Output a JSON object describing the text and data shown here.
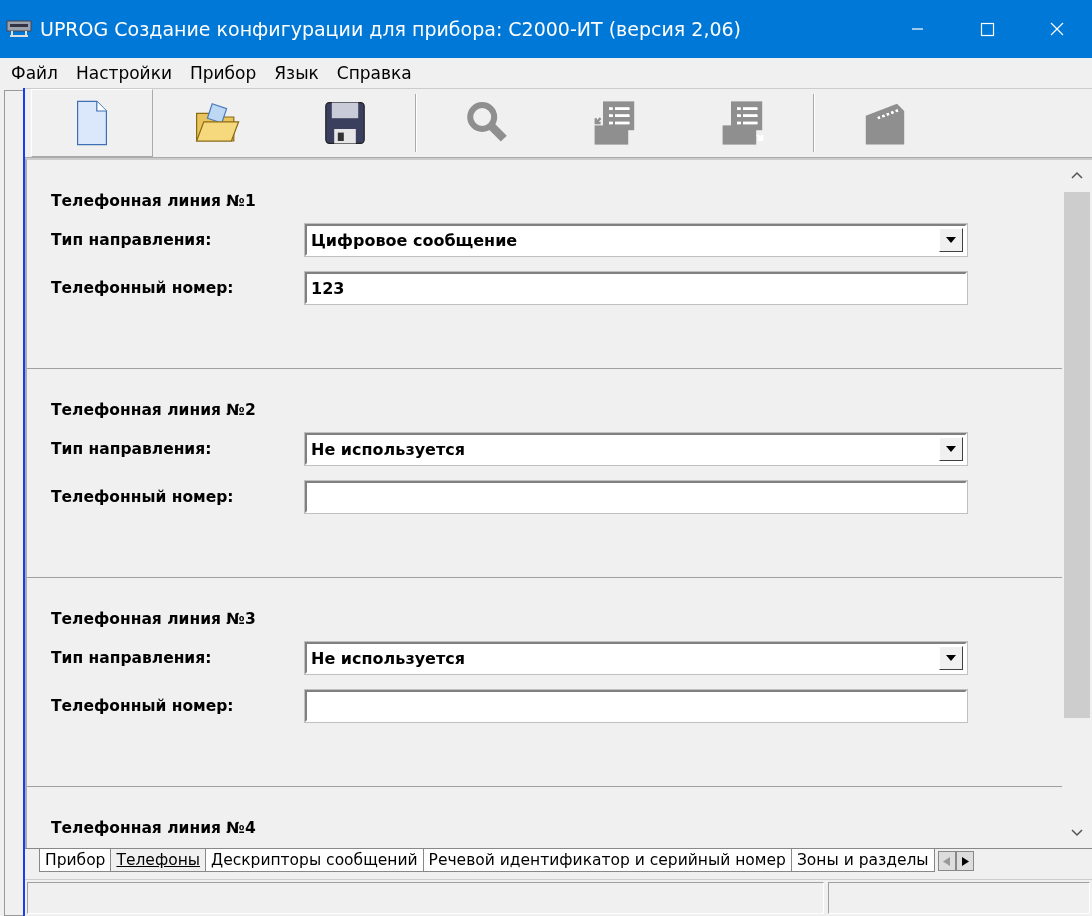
{
  "window": {
    "title": "UPROG  Создание конфигурации для прибора: С2000-ИТ (версия  2,06)"
  },
  "menu": [
    "Файл",
    "Настройки",
    "Прибор",
    "Язык",
    "Справка"
  ],
  "toolbar": [
    {
      "kind": "new",
      "disabled": false
    },
    {
      "kind": "open",
      "disabled": false
    },
    {
      "kind": "save",
      "disabled": false
    },
    {
      "kind": "separator"
    },
    {
      "kind": "search",
      "disabled": true
    },
    {
      "kind": "read",
      "disabled": true
    },
    {
      "kind": "write",
      "disabled": true
    },
    {
      "kind": "separator"
    },
    {
      "kind": "device",
      "disabled": true
    }
  ],
  "sections": [
    {
      "title": "Телефонная линия №1",
      "fields": [
        {
          "kind": "dropdown",
          "label": "Тип направления:",
          "value": "Цифровое сообщение"
        },
        {
          "kind": "text",
          "label": "Телефонный номер:",
          "value": "123"
        }
      ]
    },
    {
      "title": "Телефонная линия №2",
      "fields": [
        {
          "kind": "dropdown",
          "label": "Тип направления:",
          "value": "Не используется"
        },
        {
          "kind": "text",
          "label": "Телефонный номер:"
        }
      ]
    },
    {
      "title": "Телефонная линия №3",
      "fields": [
        {
          "kind": "dropdown",
          "label": "Тип направления:",
          "value": "Не используется"
        },
        {
          "kind": "text",
          "label": "Телефонный номер:"
        }
      ]
    },
    {
      "title": "Телефонная линия №4"
    }
  ],
  "tabs": [
    {
      "label": "Прибор",
      "selected": false
    },
    {
      "label": "Телефоны",
      "selected": true
    },
    {
      "label": "Дескрипторы сообщений",
      "selected": false
    },
    {
      "label": "Речевой идентификатор и серийный номер",
      "selected": false
    },
    {
      "label": "Зоны и разделы",
      "selected": false
    }
  ]
}
